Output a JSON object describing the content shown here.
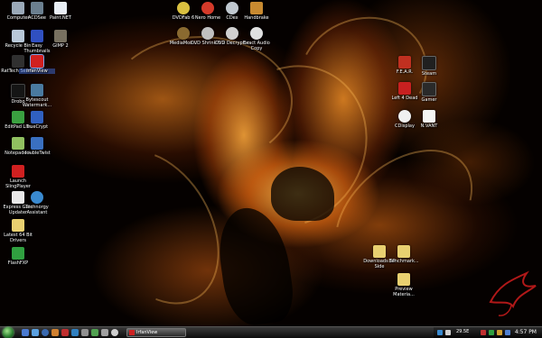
{
  "desktop": {
    "icons": [
      {
        "label": "Computer",
        "icon": "computer-icon",
        "color": "#9aa9b8"
      },
      {
        "label": "ACDSee",
        "icon": "acdsee-icon",
        "color": "#6b7f8f"
      },
      {
        "label": "Paint.NET",
        "icon": "paintnet-icon",
        "color": "#e8eef5"
      },
      {
        "label": "DVDFab 6",
        "icon": "dvdfab-icon",
        "color": "#d9c040"
      },
      {
        "label": "Nero Home",
        "icon": "nero-icon",
        "color": "#d43a2a"
      },
      {
        "label": "CDex",
        "icon": "cdex-icon",
        "color": "#c0c8d0"
      },
      {
        "label": "Handbrake",
        "icon": "handbrake-icon",
        "color": "#c88a30"
      },
      {
        "label": "Recycle Bin",
        "icon": "recycle-bin-icon",
        "color": "#b8c8d8"
      },
      {
        "label": "Easy Thumbnails",
        "icon": "easy-thumbnails-icon",
        "color": "#3050c0"
      },
      {
        "label": "GIMP 2",
        "icon": "gimp-icon",
        "color": "#777060"
      },
      {
        "label": "MediaMon...",
        "icon": "mediamonkey-icon",
        "color": "#8a6a30"
      },
      {
        "label": "DVD Shrink 3.2",
        "icon": "dvd-shrink-icon",
        "color": "#c0c0c0"
      },
      {
        "label": "DVD Decrypter",
        "icon": "dvd-decrypter-icon",
        "color": "#d0d0d0"
      },
      {
        "label": "Exact Audio Copy",
        "icon": "exact-audio-copy-icon",
        "color": "#e0e0e0"
      },
      {
        "label": "RatTech Server",
        "icon": "rattech-server-icon",
        "color": "#303030"
      },
      {
        "label": "IrfanView",
        "icon": "irfanview-icon",
        "color": "#d02020"
      },
      {
        "label": "F.E.A.R.",
        "icon": "fear-icon",
        "color": "#c03020"
      },
      {
        "label": "Steam",
        "icon": "steam-icon",
        "color": "#202020"
      },
      {
        "label": "Drobo",
        "icon": "drobo-icon",
        "color": "#151515"
      },
      {
        "label": "Bytescout Watermark...",
        "icon": "bytescout-watermarking-icon",
        "color": "#4a7aa0"
      },
      {
        "label": "Left 4 Dead",
        "icon": "left-4-dead-icon",
        "color": "#c82020"
      },
      {
        "label": "Gamer",
        "icon": "gamer-icon",
        "color": "#2a2a2a"
      },
      {
        "label": "EditPad Lite",
        "icon": "editpad-lite-icon",
        "color": "#3aa040"
      },
      {
        "label": "TrueCrypt",
        "icon": "truecrypt-icon",
        "color": "#3060c0"
      },
      {
        "label": "CDisplay",
        "icon": "cdisplay-icon",
        "color": "#f0f0f0"
      },
      {
        "label": "N.VANT",
        "icon": "nvant-icon",
        "color": "#f5f5f5"
      },
      {
        "label": "Notepad++",
        "icon": "notepad-plus-plus-icon",
        "color": "#90c060"
      },
      {
        "label": "doubleTwist",
        "icon": "doubletwist-icon",
        "color": "#3a70c0"
      },
      {
        "label": "Launch SlingPlayer",
        "icon": "slingplayer-icon",
        "color": "#d02020"
      },
      {
        "label": "Express Gate Updater",
        "icon": "express-gate-updater-icon",
        "color": "#e8e8e8"
      },
      {
        "label": "Technorgy Assistant",
        "icon": "technorgy-assistant-icon",
        "color": "#3a8ad0"
      },
      {
        "label": "Latest 64 Bit Drivers",
        "icon": "drivers-folder-icon",
        "color": "#e8d070"
      },
      {
        "label": "FlashFXP",
        "icon": "flashfxp-icon",
        "color": "#30a040"
      },
      {
        "label": "Downloads XP Side",
        "icon": "downloads-folder-icon",
        "color": "#e8d070"
      },
      {
        "label": "Benchmark...",
        "icon": "benchmark-folder-icon",
        "color": "#e8d070"
      },
      {
        "label": "Preview Materia...",
        "icon": "preview-folder-icon",
        "color": "#e8d070"
      }
    ]
  },
  "taskbar": {
    "task_button_label": "IrfanView",
    "tray_temp": "29.5E",
    "clock": "4:57 PM"
  }
}
